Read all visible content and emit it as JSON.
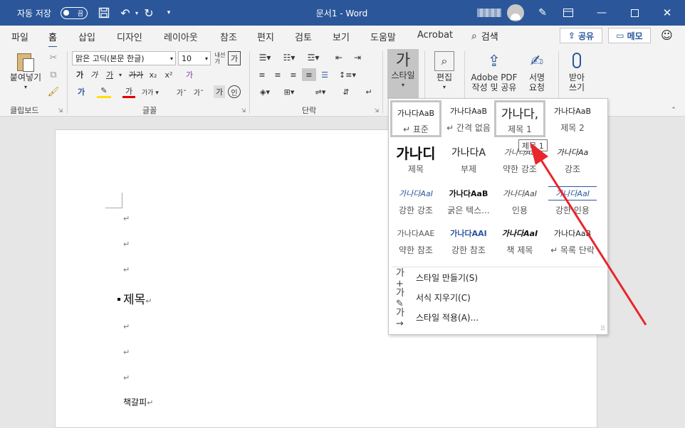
{
  "titlebar": {
    "autosave_label": "자동 저장",
    "autosave_state": "끔",
    "doc_title": "문서1 - Word"
  },
  "tabs": [
    "파일",
    "홈",
    "삽입",
    "디자인",
    "레이아웃",
    "참조",
    "편지",
    "검토",
    "보기",
    "도움말",
    "Acrobat"
  ],
  "search_label": "검색",
  "share_label": "공유",
  "memo_label": "메모",
  "ribbon": {
    "paste_label": "붙여넣기",
    "clipboard_group": "클립보드",
    "font_name": "맑은 고딕(본문 한글)",
    "font_size": "10",
    "font_group": "글꼴",
    "para_group": "단락",
    "styles_label": "스타일",
    "edit_label": "편집",
    "adobe_label_1": "Adobe PDF",
    "adobe_label_2": "작성 및 공유",
    "sign_label_1": "서명",
    "sign_label_2": "요청",
    "dictate_label_1": "받아",
    "dictate_label_2": "쓰기"
  },
  "gallery": {
    "styles": [
      {
        "preview": "가나다AaB",
        "name": "↵ 표준",
        "selected": true
      },
      {
        "preview": "가나다AaB",
        "name": "↵ 간격 없음",
        "selected": false
      },
      {
        "preview": "가나다,",
        "name": "제목 1",
        "selected": true
      },
      {
        "preview": "가나다AaB",
        "name": "제목 2",
        "selected": false
      },
      {
        "preview": "가나디",
        "name": "제목",
        "selected": false
      },
      {
        "preview": "가나다A",
        "name": "부제",
        "selected": false
      },
      {
        "preview": "가나다Aa",
        "name": "약한 강조",
        "selected": false
      },
      {
        "preview": "가나다Aa",
        "name": "강조",
        "selected": false
      },
      {
        "preview": "가나다AaI",
        "name": "강한 강조",
        "selected": false
      },
      {
        "preview": "가나다AaB",
        "name": "굵은 텍스...",
        "selected": false
      },
      {
        "preview": "가나다AaI",
        "name": "인용",
        "selected": false
      },
      {
        "preview": "가나다AaI",
        "name": "강한 인용",
        "selected": false
      },
      {
        "preview": "가나다AAE",
        "name": "약한 참조",
        "selected": false
      },
      {
        "preview": "가나다AAI",
        "name": "강한 참조",
        "selected": false
      },
      {
        "preview": "가나다AaI",
        "name": "책 제목",
        "selected": false
      },
      {
        "preview": "가나다AaB",
        "name": "↵ 목록 단락",
        "selected": false
      }
    ],
    "menu": [
      {
        "icon": "가+",
        "label": "스타일 만들기(S)"
      },
      {
        "icon": "가✎",
        "label": "서식 지우기(C)"
      },
      {
        "icon": "가→",
        "label": "스타일 적용(A)..."
      }
    ]
  },
  "tooltip": "제목 1",
  "document": {
    "heading": "제목",
    "bookmark_text": "책갈피",
    "para_mark": "↵"
  },
  "colors": {
    "accent": "#2b579a",
    "arrow": "#e8262c"
  }
}
